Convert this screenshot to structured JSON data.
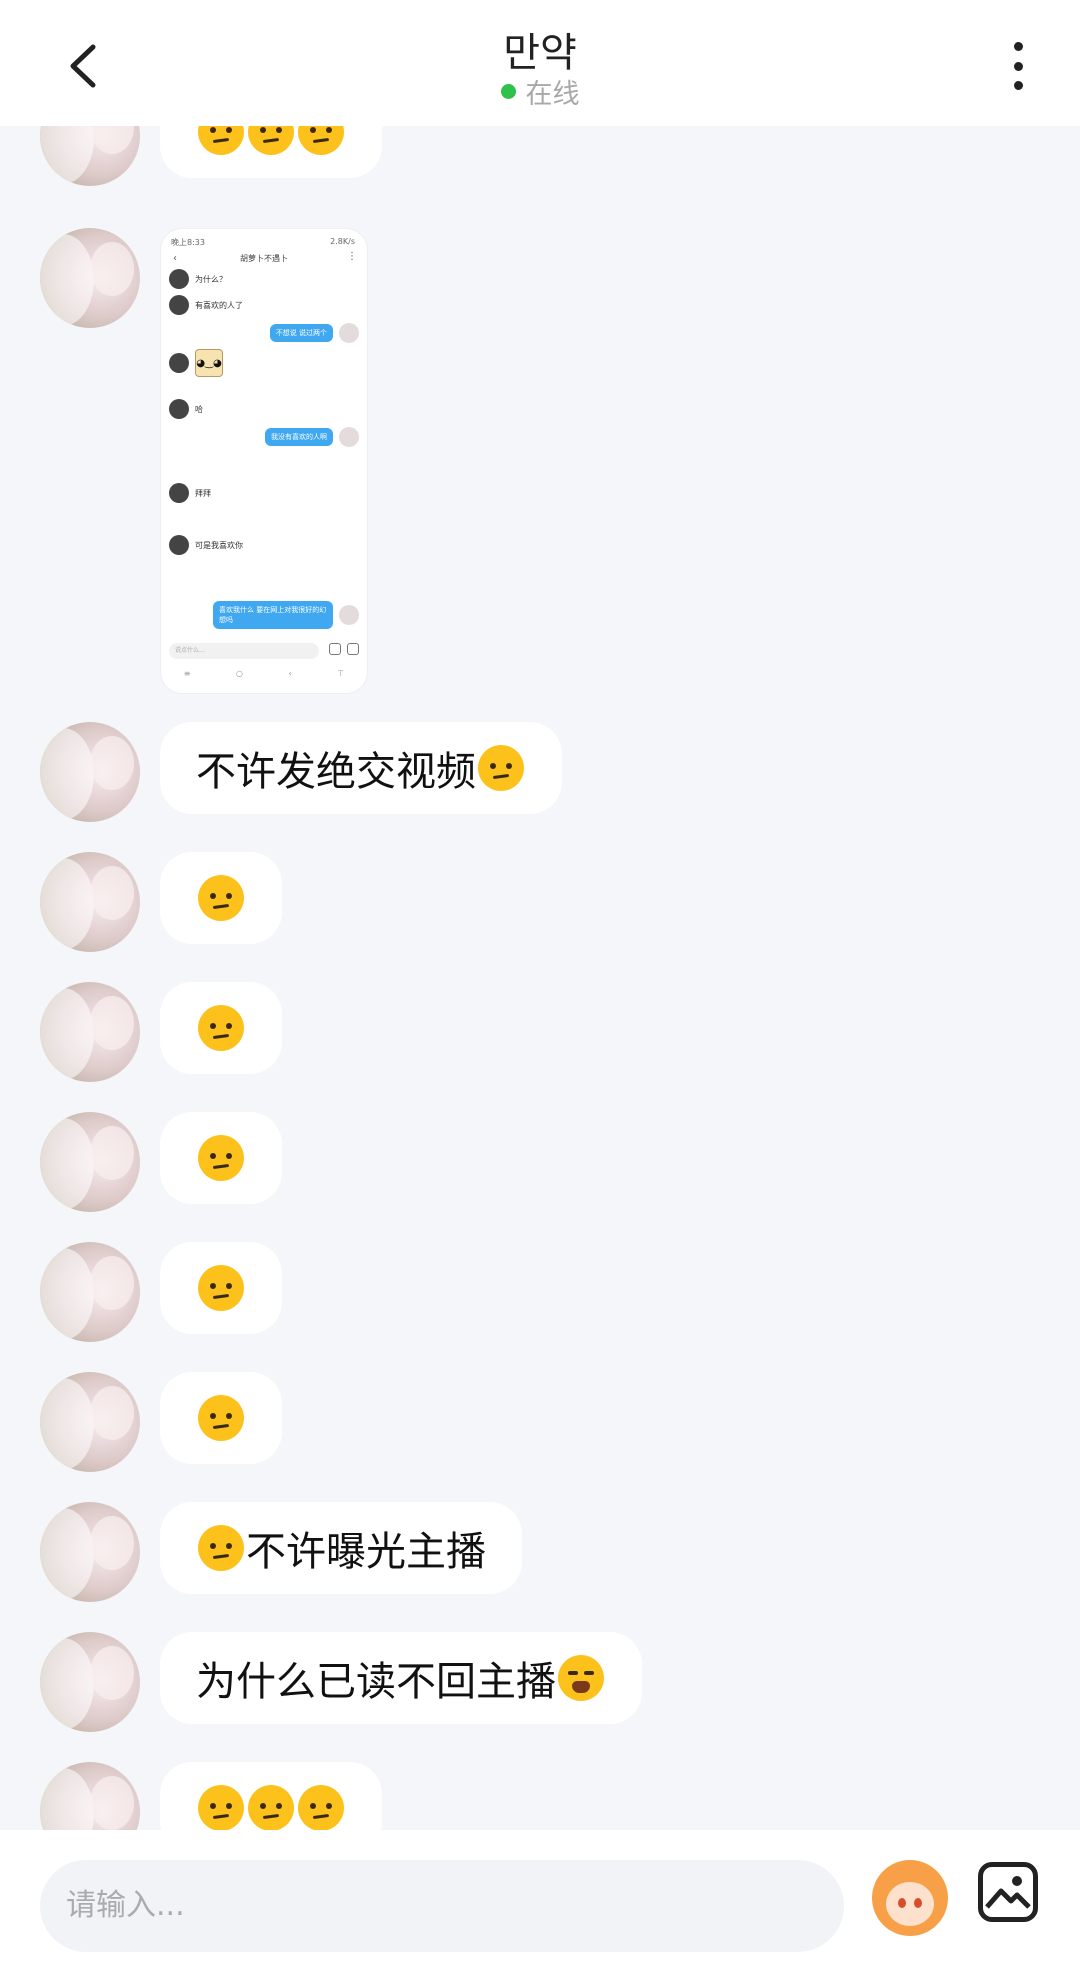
{
  "header": {
    "title": "만약",
    "status_text": "在线",
    "status_color": "#2fc24a",
    "back_icon": "chevron-left-icon",
    "more_icon": "vertical-dots-icon"
  },
  "messages": [
    {
      "type": "text",
      "text": "",
      "emoji": [
        "pouting-face",
        "pouting-face",
        "pouting-face"
      ]
    },
    {
      "type": "image",
      "description": "chat-screenshot"
    },
    {
      "type": "text",
      "text": "不许发绝交视频",
      "emoji_after": [
        "pouting-face"
      ]
    },
    {
      "type": "emoji",
      "emoji": [
        "pouting-face"
      ]
    },
    {
      "type": "emoji",
      "emoji": [
        "pouting-face"
      ]
    },
    {
      "type": "emoji",
      "emoji": [
        "pouting-face"
      ]
    },
    {
      "type": "emoji",
      "emoji": [
        "pouting-face"
      ]
    },
    {
      "type": "emoji",
      "emoji": [
        "pouting-face"
      ]
    },
    {
      "type": "text",
      "text": "不许曝光主播",
      "emoji_before": [
        "pouting-face"
      ]
    },
    {
      "type": "text",
      "text": "为什么已读不回主播",
      "emoji_after": [
        "crying-face"
      ]
    },
    {
      "type": "emoji",
      "emoji": [
        "pouting-face",
        "pouting-face",
        "pouting-face"
      ]
    }
  ],
  "screenshot": {
    "time": "晚上8:33",
    "net": "2.8K/s",
    "title": "胡萝卜不遇卜",
    "rows": [
      "为什么？",
      "有喜欢的人了",
      "不想说 说过两个",
      "哈",
      "我没有喜欢的人啊",
      "拜拜",
      "可是我喜欢你",
      "喜欢我什么 要在网上对我很好的幻想吗"
    ],
    "input_placeholder": "说点什么..."
  },
  "input": {
    "placeholder": "请输入..."
  }
}
